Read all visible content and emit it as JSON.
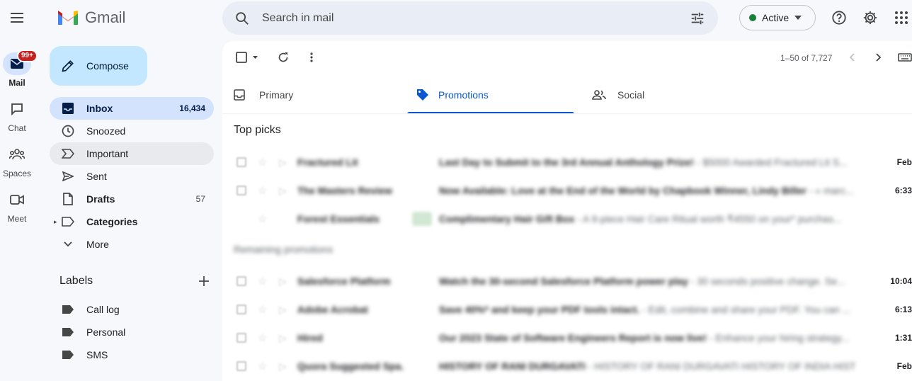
{
  "app": {
    "name": "Gmail"
  },
  "search": {
    "placeholder": "Search in mail"
  },
  "status": {
    "label": "Active"
  },
  "rail": [
    {
      "label": "Mail",
      "icon": "mail-icon",
      "badge": "99+"
    },
    {
      "label": "Chat",
      "icon": "chat-icon"
    },
    {
      "label": "Spaces",
      "icon": "spaces-icon"
    },
    {
      "label": "Meet",
      "icon": "meet-icon"
    }
  ],
  "compose": {
    "label": "Compose"
  },
  "nav": [
    {
      "label": "Inbox",
      "count": "16,434",
      "icon": "inbox-icon"
    },
    {
      "label": "Snoozed",
      "count": "",
      "icon": "clock-icon"
    },
    {
      "label": "Important",
      "count": "",
      "icon": "important-icon"
    },
    {
      "label": "Sent",
      "count": "",
      "icon": "send-icon"
    },
    {
      "label": "Drafts",
      "count": "57",
      "icon": "draft-icon"
    },
    {
      "label": "Categories",
      "count": "",
      "icon": "label-icon"
    },
    {
      "label": "More",
      "count": "",
      "icon": "chevron-down-icon"
    }
  ],
  "labels": {
    "heading": "Labels",
    "items": [
      {
        "label": "Call log"
      },
      {
        "label": "Personal"
      },
      {
        "label": "SMS"
      }
    ]
  },
  "pagination": {
    "text": "1–50 of 7,727"
  },
  "tabs": [
    {
      "label": "Primary",
      "icon": "inbox-icon"
    },
    {
      "label": "Promotions",
      "icon": "tag-icon",
      "active": true
    },
    {
      "label": "Social",
      "icon": "people-icon"
    }
  ],
  "sections": {
    "top_picks": "Top picks",
    "remaining": "Remaining promotions"
  },
  "emails_top": [
    {
      "sender": "Fractured Lit",
      "subject": "Last Day to Submit to the 3rd Annual Anthology Prize!",
      "snippet": " - $5000 Awarded Fractured Lit S...",
      "date": "Feb"
    },
    {
      "sender": "The Masters Review",
      "subject": "Now Available: Love at the End of the World by Chapbook Winner, Lindy Biller",
      "snippet": " - « marc...",
      "date": "6:33"
    },
    {
      "sender": "Forest Essentials",
      "subject": "Complimentary Hair Gift Box",
      "snippet": " - A 9-piece Hair Care Ritual worth ₹4550 on your* purchas...",
      "date": ""
    }
  ],
  "emails_rest": [
    {
      "sender": "Salesforce Platform",
      "subject": "Watch the 30-second Salesforce Platform power play",
      "snippet": " - 30 seconds positive change. Se...",
      "date": "10:04"
    },
    {
      "sender": "Adobe Acrobat",
      "subject": "Save 40%* and keep your PDF tools intact.",
      "snippet": " - Edit, combine and share your PDF. You can ...",
      "date": "6:13"
    },
    {
      "sender": "Hired",
      "subject": "Our 2023 State of Software Engineers Report is now live!",
      "snippet": " - Enhance your hiring strategy...",
      "date": "1:31"
    },
    {
      "sender": "Quora Suggested Spa.",
      "subject": "HISTORY OF RANI DURGAVATI",
      "snippet": " - HISTORY OF RANI DURGAVATI HISTORY OF INDIA HISTOR...",
      "date": "Feb"
    }
  ]
}
